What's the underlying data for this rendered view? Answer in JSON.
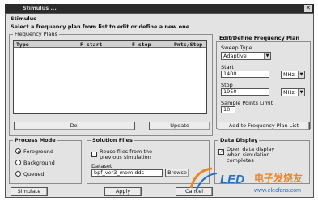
{
  "window": {
    "title": "Stimulus ...",
    "close_glyph": "✕"
  },
  "stimulus_label": "Stimulus",
  "instruction": "Select a frequency plan from list to edit or define a new one",
  "frequency_plans": {
    "title": "Frequency Plans",
    "columns": [
      "Type",
      "F start",
      "F stop",
      "Pnts/Step"
    ]
  },
  "edit_plan": {
    "title": "Edit/Define Frequency Plan",
    "sweep_type_label": "Sweep Type",
    "sweep_type_value": "Adaptive",
    "start_label": "Start",
    "start_value": "1400",
    "start_unit": "MHz",
    "stop_label": "Stop",
    "stop_value": "1950",
    "stop_unit": "MHz",
    "sample_limit_label": "Sample Points Limit",
    "sample_limit_value": "10"
  },
  "buttons": {
    "delete": "Del",
    "update": "Update",
    "add": "Add to Frequency Plan List",
    "browse": "Browse",
    "simulate": "Simulate",
    "apply": "Apply",
    "cancel": "Cancel"
  },
  "process_mode": {
    "title": "Process Mode",
    "options": [
      "Foreground",
      "Background",
      "Queued"
    ],
    "selected": "Foreground"
  },
  "solution_files": {
    "title": "Solution Files",
    "reuse_label": "Reuse files from the previous simulation",
    "dataset_label": "Dataset",
    "dataset_value": "bpf_ver3_mom.dds"
  },
  "data_display": {
    "title": "Data Display",
    "open_label": "Open data display when simulation completes"
  },
  "watermark": {
    "brand": "电子发烧友",
    "prefix": "LED",
    "url": "www.elecfans.com",
    "colors": {
      "blue": "#2a6fb8",
      "orange": "#e8862a"
    }
  },
  "accent_colors": {
    "titlebar": "#2b2b2b",
    "dialog": "#e3e3e3"
  }
}
